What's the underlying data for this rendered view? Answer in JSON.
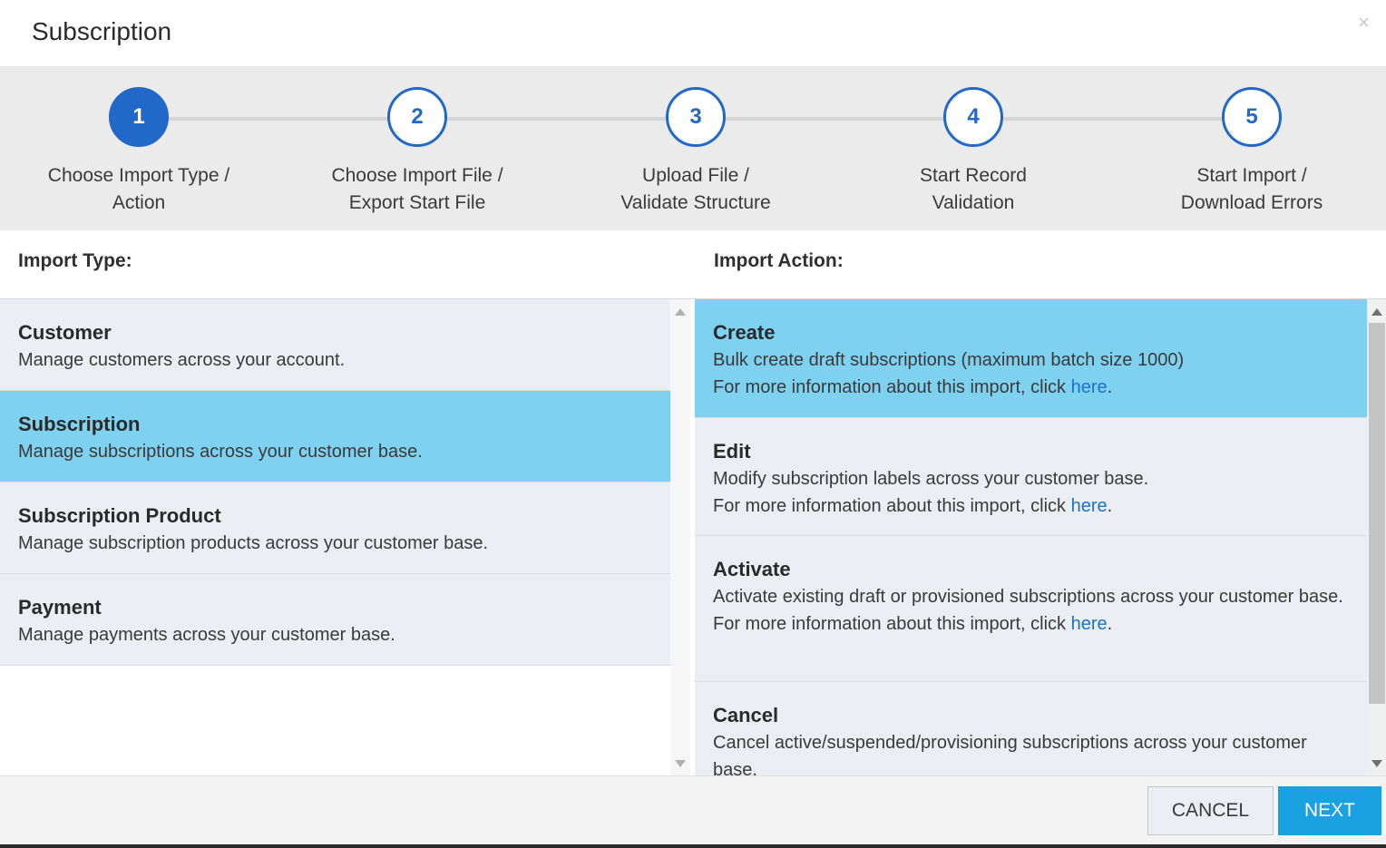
{
  "dialog": {
    "title": "Subscription",
    "close_symbol": "×"
  },
  "stepper": {
    "steps": [
      {
        "number": "1",
        "line1": "Choose Import Type /",
        "line2": "Action",
        "active": true
      },
      {
        "number": "2",
        "line1": "Choose Import File /",
        "line2": "Export Start File",
        "active": false
      },
      {
        "number": "3",
        "line1": "Upload File /",
        "line2": "Validate Structure",
        "active": false
      },
      {
        "number": "4",
        "line1": "Start Record",
        "line2": "Validation",
        "active": false
      },
      {
        "number": "5",
        "line1": "Start Import /",
        "line2": "Download Errors",
        "active": false
      }
    ]
  },
  "import_type": {
    "heading": "Import Type:",
    "items": [
      {
        "title": "Customer",
        "description": "Manage customers across your account.",
        "selected": false
      },
      {
        "title": "Subscription",
        "description": "Manage subscriptions across your customer base.",
        "selected": true
      },
      {
        "title": "Subscription Product",
        "description": "Manage subscription products across your customer base.",
        "selected": false
      },
      {
        "title": "Payment",
        "description": "Manage payments across your customer base.",
        "selected": false
      }
    ]
  },
  "import_action": {
    "heading": "Import Action:",
    "info_prefix": "For more information about this import, click ",
    "info_link": "here",
    "info_suffix": ".",
    "items": [
      {
        "title": "Create",
        "description": "Bulk create draft subscriptions (maximum batch size 1000)",
        "selected": true
      },
      {
        "title": "Edit",
        "description": "Modify subscription labels across your customer base.",
        "selected": false
      },
      {
        "title": "Activate",
        "description": "Activate existing draft or provisioned subscriptions across your customer base.",
        "selected": false
      },
      {
        "title": "Cancel",
        "description": "Cancel active/suspended/provisioning subscriptions across your customer base.",
        "selected": false
      }
    ]
  },
  "footer": {
    "cancel_label": "CANCEL",
    "next_label": "NEXT"
  },
  "colors": {
    "accent": "#2268c8",
    "selected_row": "#7fd1f0",
    "primary_button": "#1aa1e1",
    "link": "#1a73c8"
  }
}
